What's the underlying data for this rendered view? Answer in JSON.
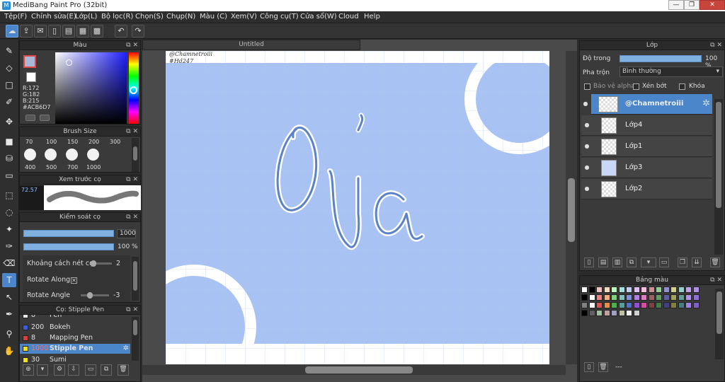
{
  "window": {
    "title": "MediBang Paint Pro (32bit)",
    "min": "—",
    "max": "❐",
    "close": "✕"
  },
  "menu": [
    "Tệp(F)",
    "Chỉnh sửa(E)",
    "Lớp(L)",
    "Bộ lọc(R)",
    "Chọn(S)",
    "Chụp(N)",
    "Màu (C)",
    "Xem(V)",
    "Công cụ(T)",
    "Cửa sổ(W)",
    "Cloud",
    "Help"
  ],
  "toolbar_icons": [
    "cloud-icon",
    "share-icon",
    "comment-icon",
    "mobile-icon",
    "page-icon",
    "panel-icon",
    "grid-icon",
    "undo-icon",
    "redo-icon"
  ],
  "color_panel": {
    "title": "Màu",
    "rgb": [
      "R:172",
      "G:182",
      "B:215"
    ],
    "hex": "#ACB6D7",
    "primary": "#ACB6D7",
    "secondary": "#FFFFFF"
  },
  "brush_size": {
    "title": "Brush Size",
    "row1": [
      "70",
      "100",
      "150",
      "200",
      "300"
    ],
    "row2": [
      "400",
      "500",
      "700",
      "1000"
    ]
  },
  "preview": {
    "title": "Xem trước cọ",
    "value": "72.57"
  },
  "brush_control": {
    "title": "Kiểm soát cọ",
    "size": "1000",
    "opacity": "100 %",
    "spacing_label": "Khoảng cách nét cọ",
    "spacing_value": "2",
    "rotate_along": "Rotate Along",
    "rotate_angle": "Rotate Angle",
    "rotate_value": "-3"
  },
  "brush_list": {
    "title": "Cọ: Stipple Pen",
    "items": [
      {
        "num": "8",
        "name": "Pen",
        "color": "#e8e8e8"
      },
      {
        "num": "200",
        "name": "Bokeh",
        "color": "#3a5fd8"
      },
      {
        "num": "8",
        "name": "Mapping Pen",
        "color": "#d84040"
      },
      {
        "num": "1000",
        "name": "Stipple Pen",
        "color": "#f0e020"
      },
      {
        "num": "30",
        "name": "Sumi",
        "color": "#f0e020"
      }
    ]
  },
  "canvas": {
    "tab": "Untitled",
    "watermark1": "@Chamnetroiii",
    "watermark2": "#Hd247",
    "text": "Ủa",
    "background": "#A9C2F4"
  },
  "layers_panel": {
    "title": "Lớp",
    "opacity_label": "Độ trong",
    "opacity_value": "100 %",
    "opacity_fraction": 1.0,
    "blend_label": "Pha trộn",
    "blend_value": "Bình thường",
    "protect_alpha": "Bảo vệ alpha",
    "clip": "Xén bớt",
    "lock": "Khóa",
    "layers": [
      "@Chamnetroiii",
      "Lớp4",
      "Lớp1",
      "Lớp3",
      "Lớp2"
    ]
  },
  "palette": {
    "title": "Bảng màu",
    "footer": "---",
    "row1": [
      "#ffffff",
      "#000000",
      "#f4c0c0",
      "#f4d8c0",
      "#c0f4c0",
      "#a0e0e0",
      "#c0d0f4",
      "#e0c0f4",
      "#f4c0e0",
      "#d09090",
      "#90d090",
      "#9090d0",
      "#d0d090",
      "#90d0d0",
      "#c0a0f0",
      "#b090e0"
    ],
    "row2": [
      "#000000",
      "#ffffff",
      "#f08080",
      "#f0b080",
      "#80d080",
      "#80c0c0",
      "#8090e0",
      "#b080e0",
      "#e080c0",
      "#a06060",
      "#60a060",
      "#6060a0",
      "#a0a060",
      "#60a0a0",
      "#b090f0",
      "#9070d0"
    ],
    "row3": [
      "#808080",
      "#ffffff",
      "#e05050",
      "#e09050",
      "#50b050",
      "#50a0a0",
      "#5070d0",
      "#9050d0",
      "#d050a0",
      "#804040",
      "#408040",
      "#404080",
      "#808040",
      "#408080",
      "#a080f0",
      "#8060c0"
    ],
    "row4": [
      "#000000",
      "#606060",
      "#a0c0a0",
      "#c0a0a0",
      "#a0a0c0",
      "#c0c0a0",
      "#f0f0f0",
      "#d0d0d0"
    ]
  },
  "left_tools": [
    "brush-icon",
    "eraser-icon",
    "rect-select-icon",
    "pen-icon",
    "move-icon",
    "fill-rect-icon",
    "bucket-icon",
    "gradient-icon",
    "lasso-rect-icon",
    "lasso-icon",
    "magic-wand-icon",
    "select-pen-icon",
    "select-eraser-icon",
    "text-icon",
    "operation-icon",
    "eyedropper-icon",
    "dropper-icon",
    "hand-icon"
  ]
}
